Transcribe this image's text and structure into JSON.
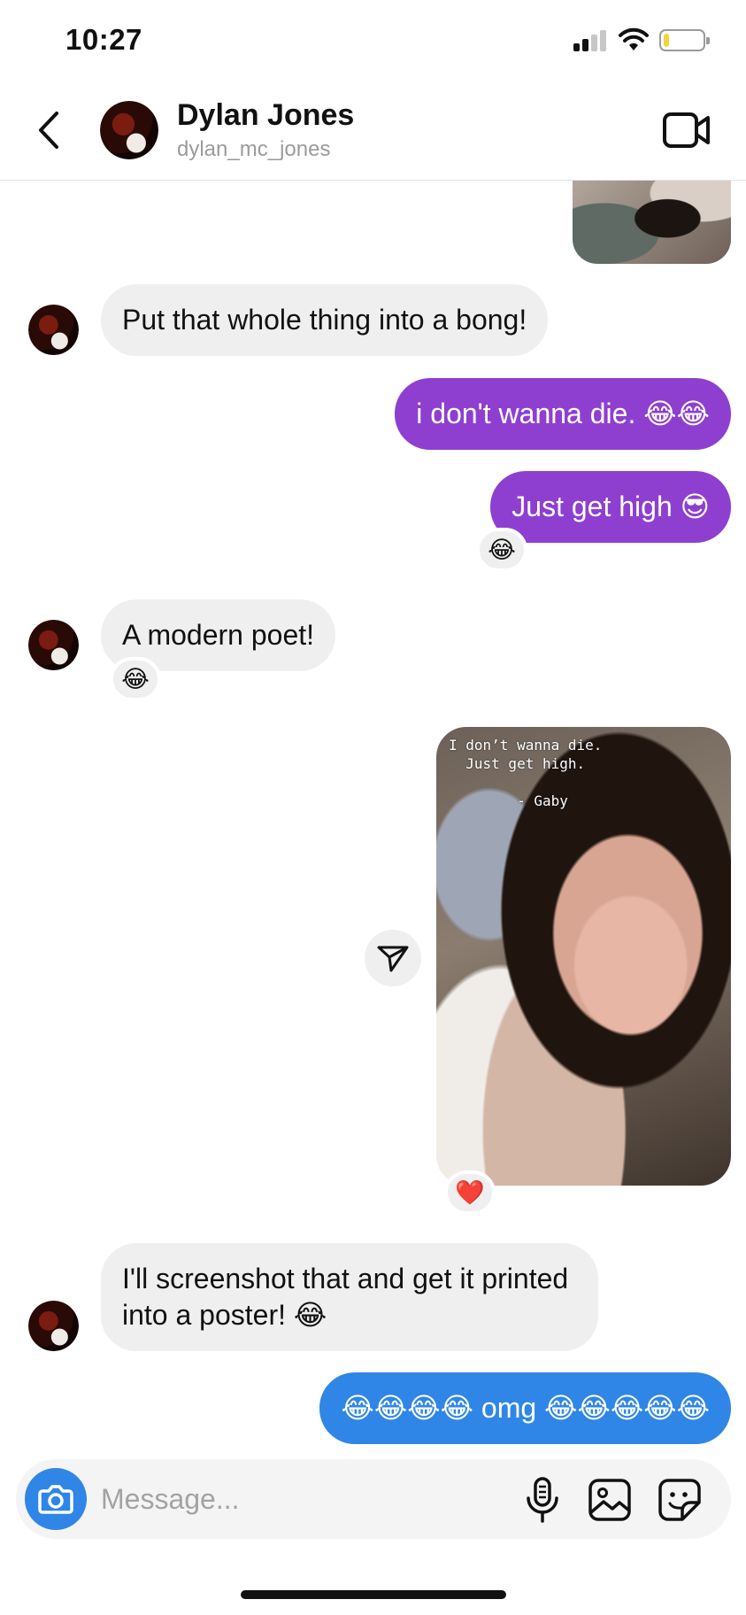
{
  "status_bar": {
    "time": "10:27",
    "battery_level": 0.15,
    "signal_bars": 2
  },
  "header": {
    "name": "Dylan Jones",
    "username": "dylan_mc_jones"
  },
  "messages": [
    {
      "direction": "incoming",
      "text": "Put that whole thing into a bong!"
    },
    {
      "direction": "outgoing",
      "text": "i don't wanna die. 😂😂"
    },
    {
      "direction": "outgoing",
      "text": "Just get high 😎",
      "reaction": "😂"
    },
    {
      "direction": "incoming",
      "text": "A modern poet!",
      "reaction": "😂"
    },
    {
      "direction": "outgoing",
      "type": "story_reply",
      "reaction": "❤️",
      "story_text": "I don’t wanna die.\n  Just get high.\n\n        - Gaby"
    },
    {
      "direction": "incoming",
      "text_line1": "I'll screenshot that and get it printed",
      "text_line2": "into a poster! 😂"
    },
    {
      "direction": "outgoing",
      "text": "😂😂😂😂 omg 😂😂😂😂😂"
    }
  ],
  "composer": {
    "placeholder": "Message..."
  },
  "colors": {
    "outgoing_purple": "#8e3fd0",
    "outgoing_blue": "#2f86e6",
    "incoming_gray": "#efefef"
  }
}
